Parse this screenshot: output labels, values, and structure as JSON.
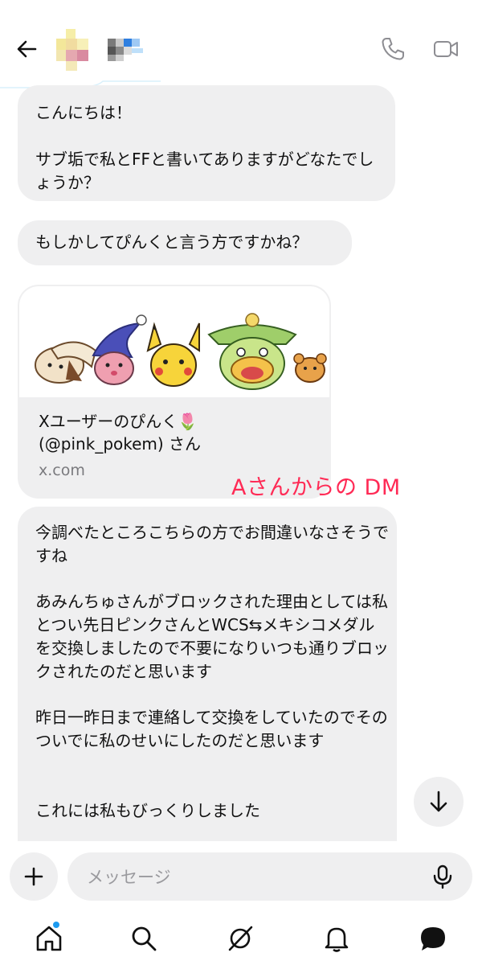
{
  "header": {
    "back_icon": "arrow-left-icon",
    "call_icon": "phone-icon",
    "video_icon": "video-camera-icon"
  },
  "messages": {
    "m1_line1": "こんにちは！",
    "m1_line2": "サブ垢で私とFFと書いてありますがどなたでしょうか？",
    "m2": "もしかしてぴんくと言う方ですかね？",
    "m3_p1": "今調べたところこちらの方でお間違いなさそうですね",
    "m3_p2": "あみんちゅさんがブロックされた理由としては私とつい先日ピンクさんとWCS⇆メキシコメダルを交換しましたので不要になりいつも通りブロックされたのだと思います",
    "m3_p3": "昨日一昨日まで連絡して交換をしていたのでそのついでに私のせいにしたのだと思います",
    "m3_p4": "これには私もびっくりしました"
  },
  "link_card": {
    "title": "Xユーザーのぴんく🌷\n(@pink_pokem) さん",
    "domain": "x.com"
  },
  "annotation": "Aさんからの DM",
  "composer": {
    "placeholder": "メッセージ",
    "plus_icon": "plus-icon",
    "mic_icon": "microphone-icon"
  },
  "nav": {
    "items": [
      "home-icon",
      "search-icon",
      "grok-icon",
      "bell-icon",
      "messages-icon"
    ]
  },
  "colors": {
    "bubble": "#efeff0",
    "annotation": "#ff2a55",
    "badge": "#1d9bf0"
  }
}
